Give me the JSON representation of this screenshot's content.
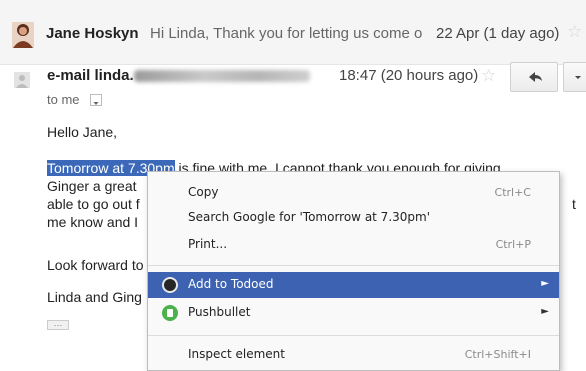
{
  "thread_row": {
    "sender": "Jane Hoskyn",
    "snippet": "Hi Linda, Thank you for letting us come o",
    "date": "22 Apr (1 day ago)",
    "star": "☆"
  },
  "message": {
    "sender": "e-mail linda.",
    "time": "18:47 (20 hours ago)",
    "star": "☆",
    "reply_icon": "reply-arrow-icon",
    "more_icon": "chevron-down-icon",
    "to": "to me"
  },
  "body": {
    "greeting": "Hello Jane,",
    "line1_selected": "Tomorrow at 7.30pm",
    "line1_rest": " is fine with me. I cannot thank you enough for giving",
    "line2": "Ginger a great",
    "line3": "able to go out f",
    "line3_end": "t",
    "line4": "me know and I",
    "look_forward": "Look forward to",
    "signoff": "Linda and Ging",
    "ellipsis": "···"
  },
  "context_menu": {
    "items": [
      {
        "label": "Copy",
        "shortcut": "Ctrl+C"
      },
      {
        "label": "Search Google for 'Tomorrow at 7.30pm'",
        "shortcut": ""
      },
      {
        "label": "Print...",
        "shortcut": "Ctrl+P"
      },
      {
        "label": "Add to Todoed",
        "submenu": "►",
        "highlighted": true
      },
      {
        "label": "Pushbullet",
        "submenu": "►"
      },
      {
        "label": "Inspect element",
        "shortcut": "Ctrl+Shift+I"
      }
    ],
    "highlight_color": "#3d62b2"
  },
  "colors": {
    "selection": "#3b68b8",
    "thread_bg": "#f5f5f5"
  }
}
